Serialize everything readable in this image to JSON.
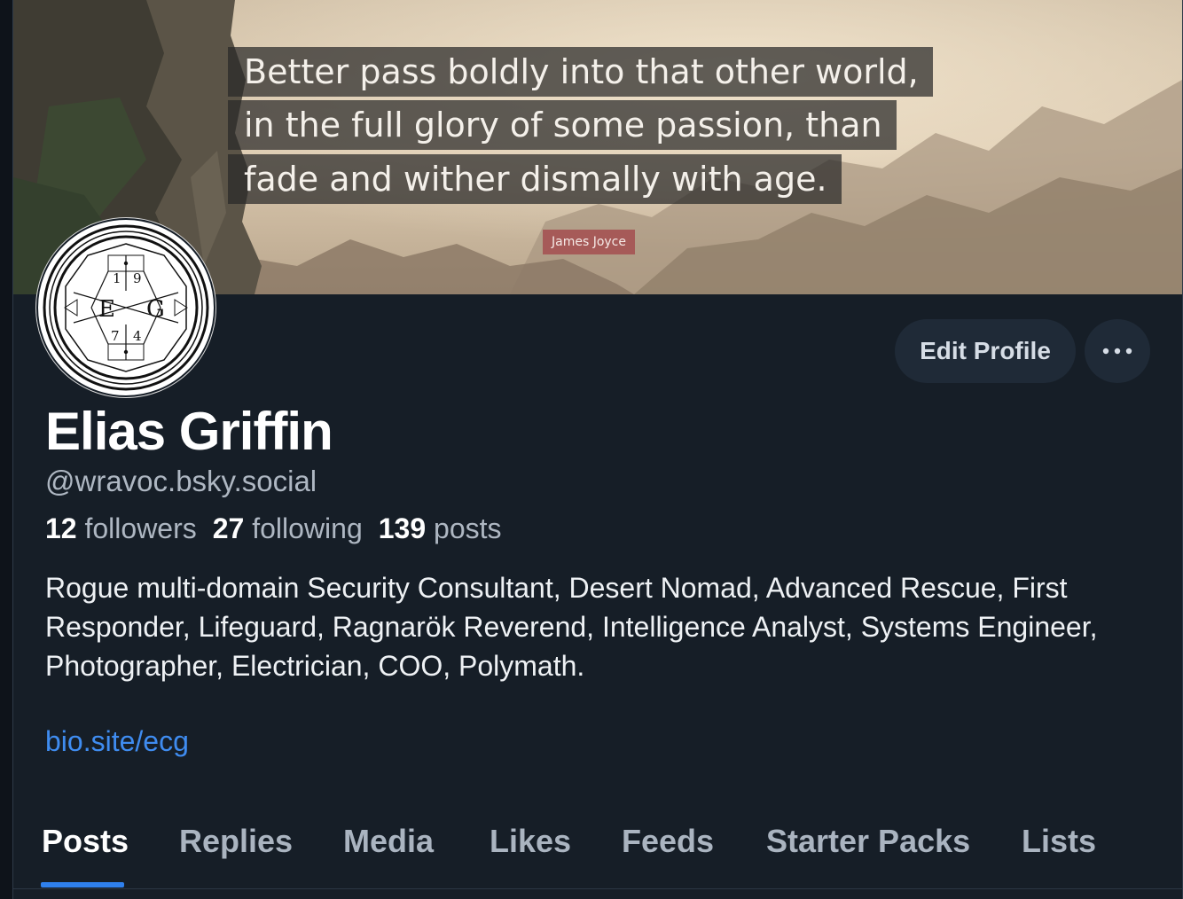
{
  "banner": {
    "quote_lines": [
      "Better pass boldly into that other world,",
      "in the full glory of some passion, than",
      "fade and wither dismally with age."
    ],
    "author": "James Joyce"
  },
  "avatar": {
    "letters": [
      "E",
      "G"
    ],
    "digits": [
      "1",
      "9",
      "7",
      "4"
    ]
  },
  "actions": {
    "edit_profile_label": "Edit Profile",
    "more_icon": "ellipsis-icon"
  },
  "profile": {
    "name": "Elias Griffin",
    "handle": "@wravoc.bsky.social",
    "followers_count": "12",
    "followers_label": "followers",
    "following_count": "27",
    "following_label": "following",
    "posts_count": "139",
    "posts_label": "posts",
    "bio": "Rogue multi-domain Security Consultant, Desert Nomad, Advanced Rescue, First Responder, Lifeguard, Ragnarök Reverend, Intelligence Analyst, Systems Engineer, Photographer, Electrician, COO, Polymath.",
    "link": "bio.site/ecg"
  },
  "tabs": [
    "Posts",
    "Replies",
    "Media",
    "Likes",
    "Feeds",
    "Starter Packs",
    "Lists"
  ],
  "active_tab": "Posts",
  "colors": {
    "background": "#161e27",
    "accent": "#2f80ed",
    "link": "#3f8cf0",
    "button": "#1f2a37"
  }
}
